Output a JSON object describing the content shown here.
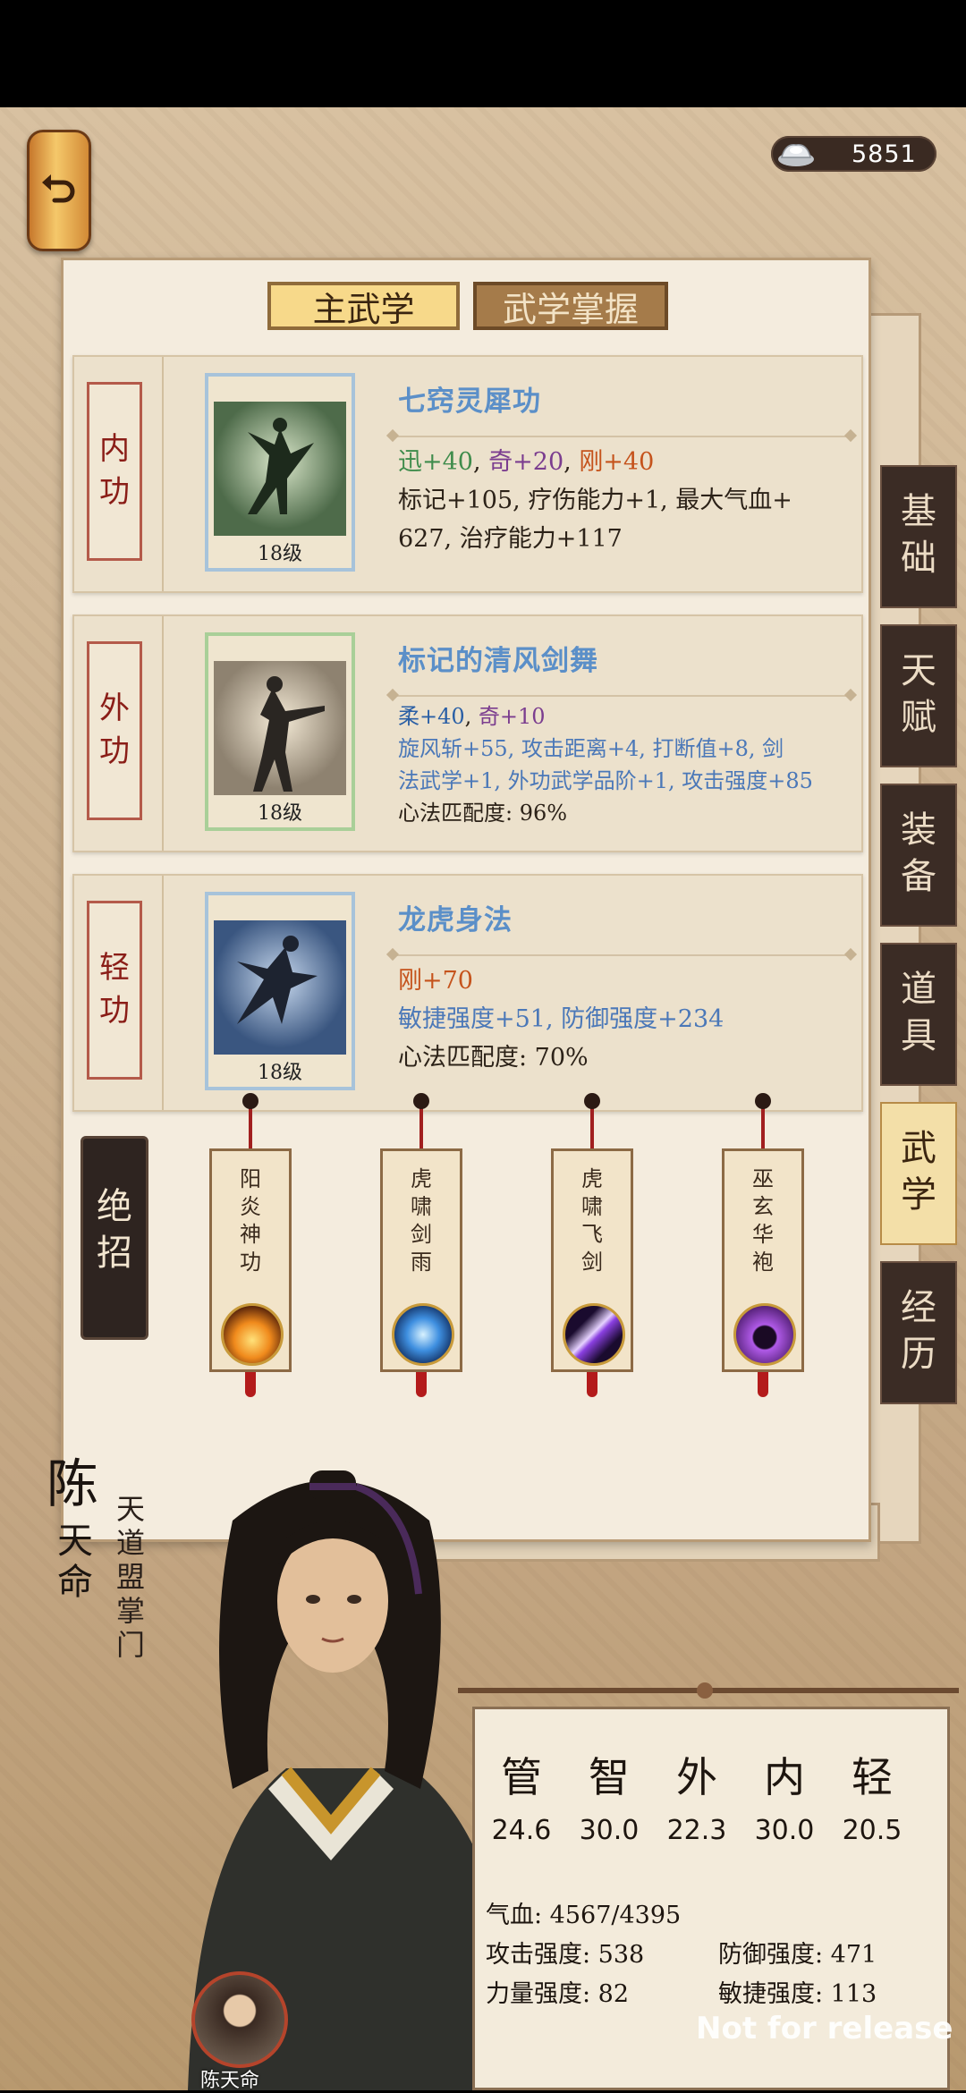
{
  "header": {
    "currency_icon": "silver-ingot-icon",
    "currency_value": "5851"
  },
  "tabs": {
    "main": "主武学",
    "mastery": "武学掌握"
  },
  "skills": [
    {
      "category": [
        "内",
        "功"
      ],
      "name": "七窍灵犀功",
      "level": "18级",
      "bonus": [
        {
          "t": "迅+40",
          "c": "g"
        },
        {
          "t": "奇+20",
          "c": "p"
        },
        {
          "t": "刚+40",
          "c": "o"
        }
      ],
      "desc": [
        "标记+105, 疗伤能力+1, 最大气血+",
        "627, 治疗能力+117"
      ]
    },
    {
      "category": [
        "外",
        "功"
      ],
      "name": "标记的清风剑舞",
      "level": "18级",
      "bonus": [
        {
          "t": "柔+40",
          "c": "b"
        },
        {
          "t": "奇+10",
          "c": "p"
        }
      ],
      "desc": [
        "旋风斩+55, 攻击距离+4, 打断值+8, 剑",
        "法武学+1, 外功武学品阶+1, 攻击强度+85",
        "心法匹配度: 96%"
      ]
    },
    {
      "category": [
        "轻",
        "功"
      ],
      "name": "龙虎身法",
      "level": "18级",
      "bonus": [
        {
          "t": "刚+70",
          "c": "o"
        }
      ],
      "desc": [
        "敏捷强度+51, 防御强度+234",
        "心法匹配度: 70%"
      ]
    }
  ],
  "ultimate": {
    "label": [
      "绝",
      "招"
    ],
    "moves": [
      {
        "name": [
          "阳",
          "炎",
          "神",
          "功"
        ],
        "icon": "fire-burst-icon"
      },
      {
        "name": [
          "虎",
          "啸",
          "剑",
          "雨"
        ],
        "icon": "ice-shards-icon"
      },
      {
        "name": [
          "虎",
          "啸",
          "飞",
          "剑"
        ],
        "icon": "purple-slash-icon"
      },
      {
        "name": [
          "巫",
          "玄",
          "华",
          "袍"
        ],
        "icon": "hooded-figure-icon"
      }
    ]
  },
  "side_tabs": [
    {
      "label": [
        "基",
        "础"
      ],
      "active": false
    },
    {
      "label": [
        "天",
        "赋"
      ],
      "active": false
    },
    {
      "label": [
        "装",
        "备"
      ],
      "active": false
    },
    {
      "label": [
        "道",
        "具"
      ],
      "active": false
    },
    {
      "label": [
        "武",
        "学"
      ],
      "active": true
    },
    {
      "label": [
        "经",
        "历"
      ],
      "active": false
    }
  ],
  "character": {
    "name_top": "陈",
    "name_rest": [
      "天",
      "命"
    ],
    "title": [
      "天",
      "道",
      "盟",
      "掌",
      "门"
    ],
    "avatar_name": "陈天命"
  },
  "stats": {
    "headers": [
      "管",
      "智",
      "外",
      "内",
      "轻"
    ],
    "values": [
      "24.6",
      "30.0",
      "22.3",
      "30.0",
      "20.5"
    ],
    "hp": "气血: 4567/4395",
    "attack": "攻击强度: 538",
    "defense": "防御强度: 471",
    "strength": "力量强度: 82",
    "agility": "敏捷强度: 113"
  },
  "watermark": "Not for release",
  "colors": {
    "skill_name": "#5b8fc8",
    "category_text": "#8a1d17",
    "active_tab": "#f7d98a"
  }
}
